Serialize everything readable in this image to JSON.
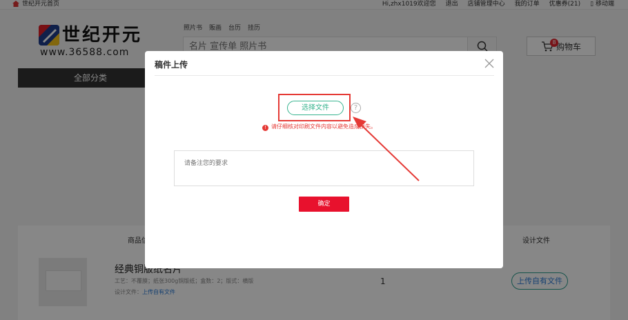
{
  "topbar": {
    "home_label": "世纪开元首页",
    "links": [
      "Hi,zhx1019欢迎您",
      "退出",
      "店铺管理中心",
      "我的订单",
      "优惠券(21)",
      "移动端"
    ]
  },
  "header": {
    "logo_text": "世纪开元",
    "logo_url": "www.36588.com",
    "search_tags": [
      "照片书",
      "贩画",
      "台历",
      "挂历"
    ],
    "search_placeholder": "名片 宣传单 照片书",
    "cart_label": "购物车",
    "cart_count": "8",
    "category_label": "全部分类"
  },
  "order": {
    "col_goods": "商品信",
    "col_design": "设计文件",
    "product_name": "经典铜版纸名片",
    "product_spec": "工艺：不覆膜；纸张300g铜版纸；盒数：2；版式：横版",
    "design_file_label": "设计文件：",
    "design_file_link": "上传自有文件",
    "quantity": "1",
    "upload_own_button": "上传自有文件"
  },
  "modal": {
    "title": "稿件上传",
    "choose_file_button": "选择文件",
    "help_symbol": "?",
    "warning_text": "请仔细核对印刷文件内容以避免造成损失。",
    "remark_placeholder": "请备注您的要求",
    "confirm_button": "确定"
  },
  "colors": {
    "accent_red": "#e8112d",
    "highlight_red": "#e53935",
    "choose_green": "#36b38e",
    "link_blue": "#2a7ad6"
  }
}
